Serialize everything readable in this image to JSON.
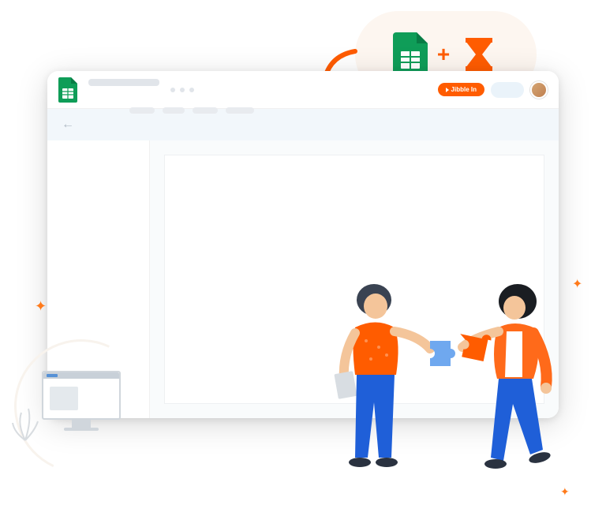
{
  "toolbar": {
    "jibble_label": "Jibble In"
  },
  "integration": {
    "plus": "+"
  }
}
